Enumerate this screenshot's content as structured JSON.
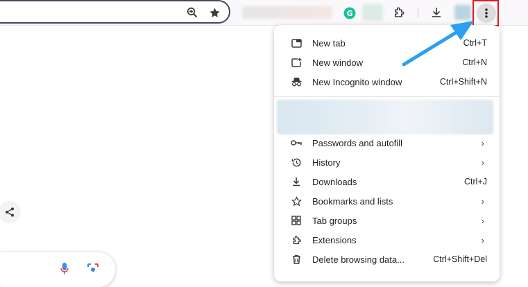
{
  "toolbar": {
    "icons": {
      "zoom": "zoom-in-icon",
      "bookmark": "star-icon",
      "grammarly": "grammarly-icon",
      "extensions": "puzzle-icon",
      "downloads": "download-icon",
      "menu": "vertical-dots-icon"
    }
  },
  "menu": {
    "items": [
      {
        "label": "New tab",
        "shortcut": "Ctrl+T",
        "icon": "new-tab-icon"
      },
      {
        "label": "New window",
        "shortcut": "Ctrl+N",
        "icon": "new-window-icon"
      },
      {
        "label": "New Incognito window",
        "shortcut": "Ctrl+Shift+N",
        "icon": "incognito-icon"
      },
      {
        "label": "Passwords and autofill",
        "shortcut": "",
        "icon": "key-icon",
        "submenu": true
      },
      {
        "label": "History",
        "shortcut": "",
        "icon": "history-icon",
        "submenu": true
      },
      {
        "label": "Downloads",
        "shortcut": "Ctrl+J",
        "icon": "download-icon"
      },
      {
        "label": "Bookmarks and lists",
        "shortcut": "",
        "icon": "star-outline-icon",
        "submenu": true
      },
      {
        "label": "Tab groups",
        "shortcut": "",
        "icon": "tab-groups-icon",
        "submenu": true
      },
      {
        "label": "Extensions",
        "shortcut": "",
        "icon": "puzzle-icon",
        "submenu": true
      },
      {
        "label": "Delete browsing data...",
        "shortcut": "Ctrl+Shift+Del",
        "icon": "trash-icon"
      }
    ],
    "chevron": "›"
  },
  "colors": {
    "highlight": "#e11b22",
    "annotation_arrow": "#2b9ff0"
  }
}
